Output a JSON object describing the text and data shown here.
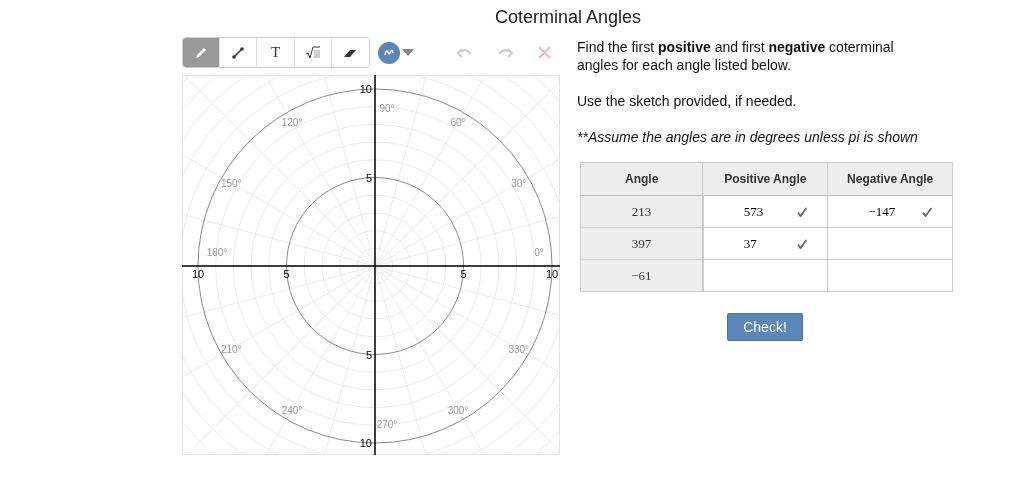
{
  "title": "Coterminal Angles",
  "toolbar": {
    "tools": [
      {
        "kind": "pencil",
        "selected": true
      },
      {
        "kind": "line",
        "selected": false
      },
      {
        "kind": "text",
        "label": "T",
        "selected": false
      },
      {
        "kind": "math",
        "selected": false
      },
      {
        "kind": "eraser",
        "selected": false
      }
    ],
    "actions": [
      {
        "kind": "undo",
        "disabled": true
      },
      {
        "kind": "redo",
        "disabled": true
      },
      {
        "kind": "clear",
        "disabled": true
      }
    ]
  },
  "sketch": {
    "x_axis_labels": [
      "10",
      "5",
      "5",
      "10"
    ],
    "y_axis_labels": [
      "10",
      "5",
      "5",
      "10"
    ],
    "angle_labels": [
      "0°",
      "30°",
      "60°",
      "90°",
      "120°",
      "150°",
      "180°",
      "210°",
      "240°",
      "270°",
      "300°",
      "330°"
    ]
  },
  "instructions": [
    "Find the first **positive** and first **negative** coterminal angles for each angle listed below.",
    "Use the sketch provided, if needed.",
    "**Assume the angles are in degrees unless pi is shown"
  ],
  "table": {
    "columns": [
      "Angle",
      "Positive Angle",
      "Negative Angle"
    ],
    "rows": [
      {
        "angle": "213",
        "positive": {
          "value": "573",
          "correct": true
        },
        "negative": {
          "value": "−147",
          "correct": true
        }
      },
      {
        "angle": "397",
        "positive": {
          "value": "37",
          "correct": true
        }
      },
      {
        "angle": "−61"
      }
    ]
  },
  "check_button": "Check!"
}
